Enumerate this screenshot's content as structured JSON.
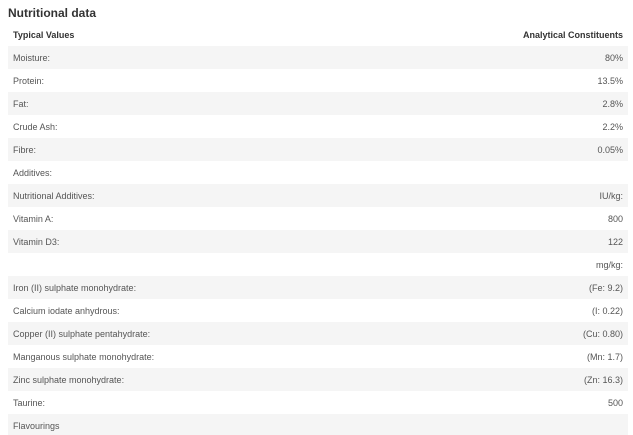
{
  "section": {
    "title": "Nutritional data"
  },
  "table": {
    "headers": [
      "Typical Values",
      "Analytical Constituents"
    ],
    "rows": [
      {
        "label": "Moisture:",
        "value": "80%"
      },
      {
        "label": "Protein:",
        "value": "13.5%"
      },
      {
        "label": "Fat:",
        "value": "2.8%"
      },
      {
        "label": "Crude Ash:",
        "value": "2.2%"
      },
      {
        "label": "Fibre:",
        "value": "0.05%"
      },
      {
        "label": "Additives:",
        "value": ""
      },
      {
        "label": "Nutritional Additives:",
        "value": "IU/kg:"
      },
      {
        "label": "Vitamin A:",
        "value": "800"
      },
      {
        "label": "Vitamin D3:",
        "value": "122"
      },
      {
        "label": "",
        "value": "mg/kg:"
      },
      {
        "label": "Iron (II) sulphate monohydrate:",
        "value": "(Fe: 9.2)"
      },
      {
        "label": "Calcium iodate anhydrous:",
        "value": "(I: 0.22)"
      },
      {
        "label": "Copper (II) sulphate pentahydrate:",
        "value": "(Cu: 0.80)"
      },
      {
        "label": "Manganous sulphate monohydrate:",
        "value": "(Mn: 1.7)"
      },
      {
        "label": "Zinc sulphate monohydrate:",
        "value": "(Zn: 16.3)"
      },
      {
        "label": "Taurine:",
        "value": "500"
      },
      {
        "label": "Flavourings",
        "value": ""
      }
    ]
  }
}
